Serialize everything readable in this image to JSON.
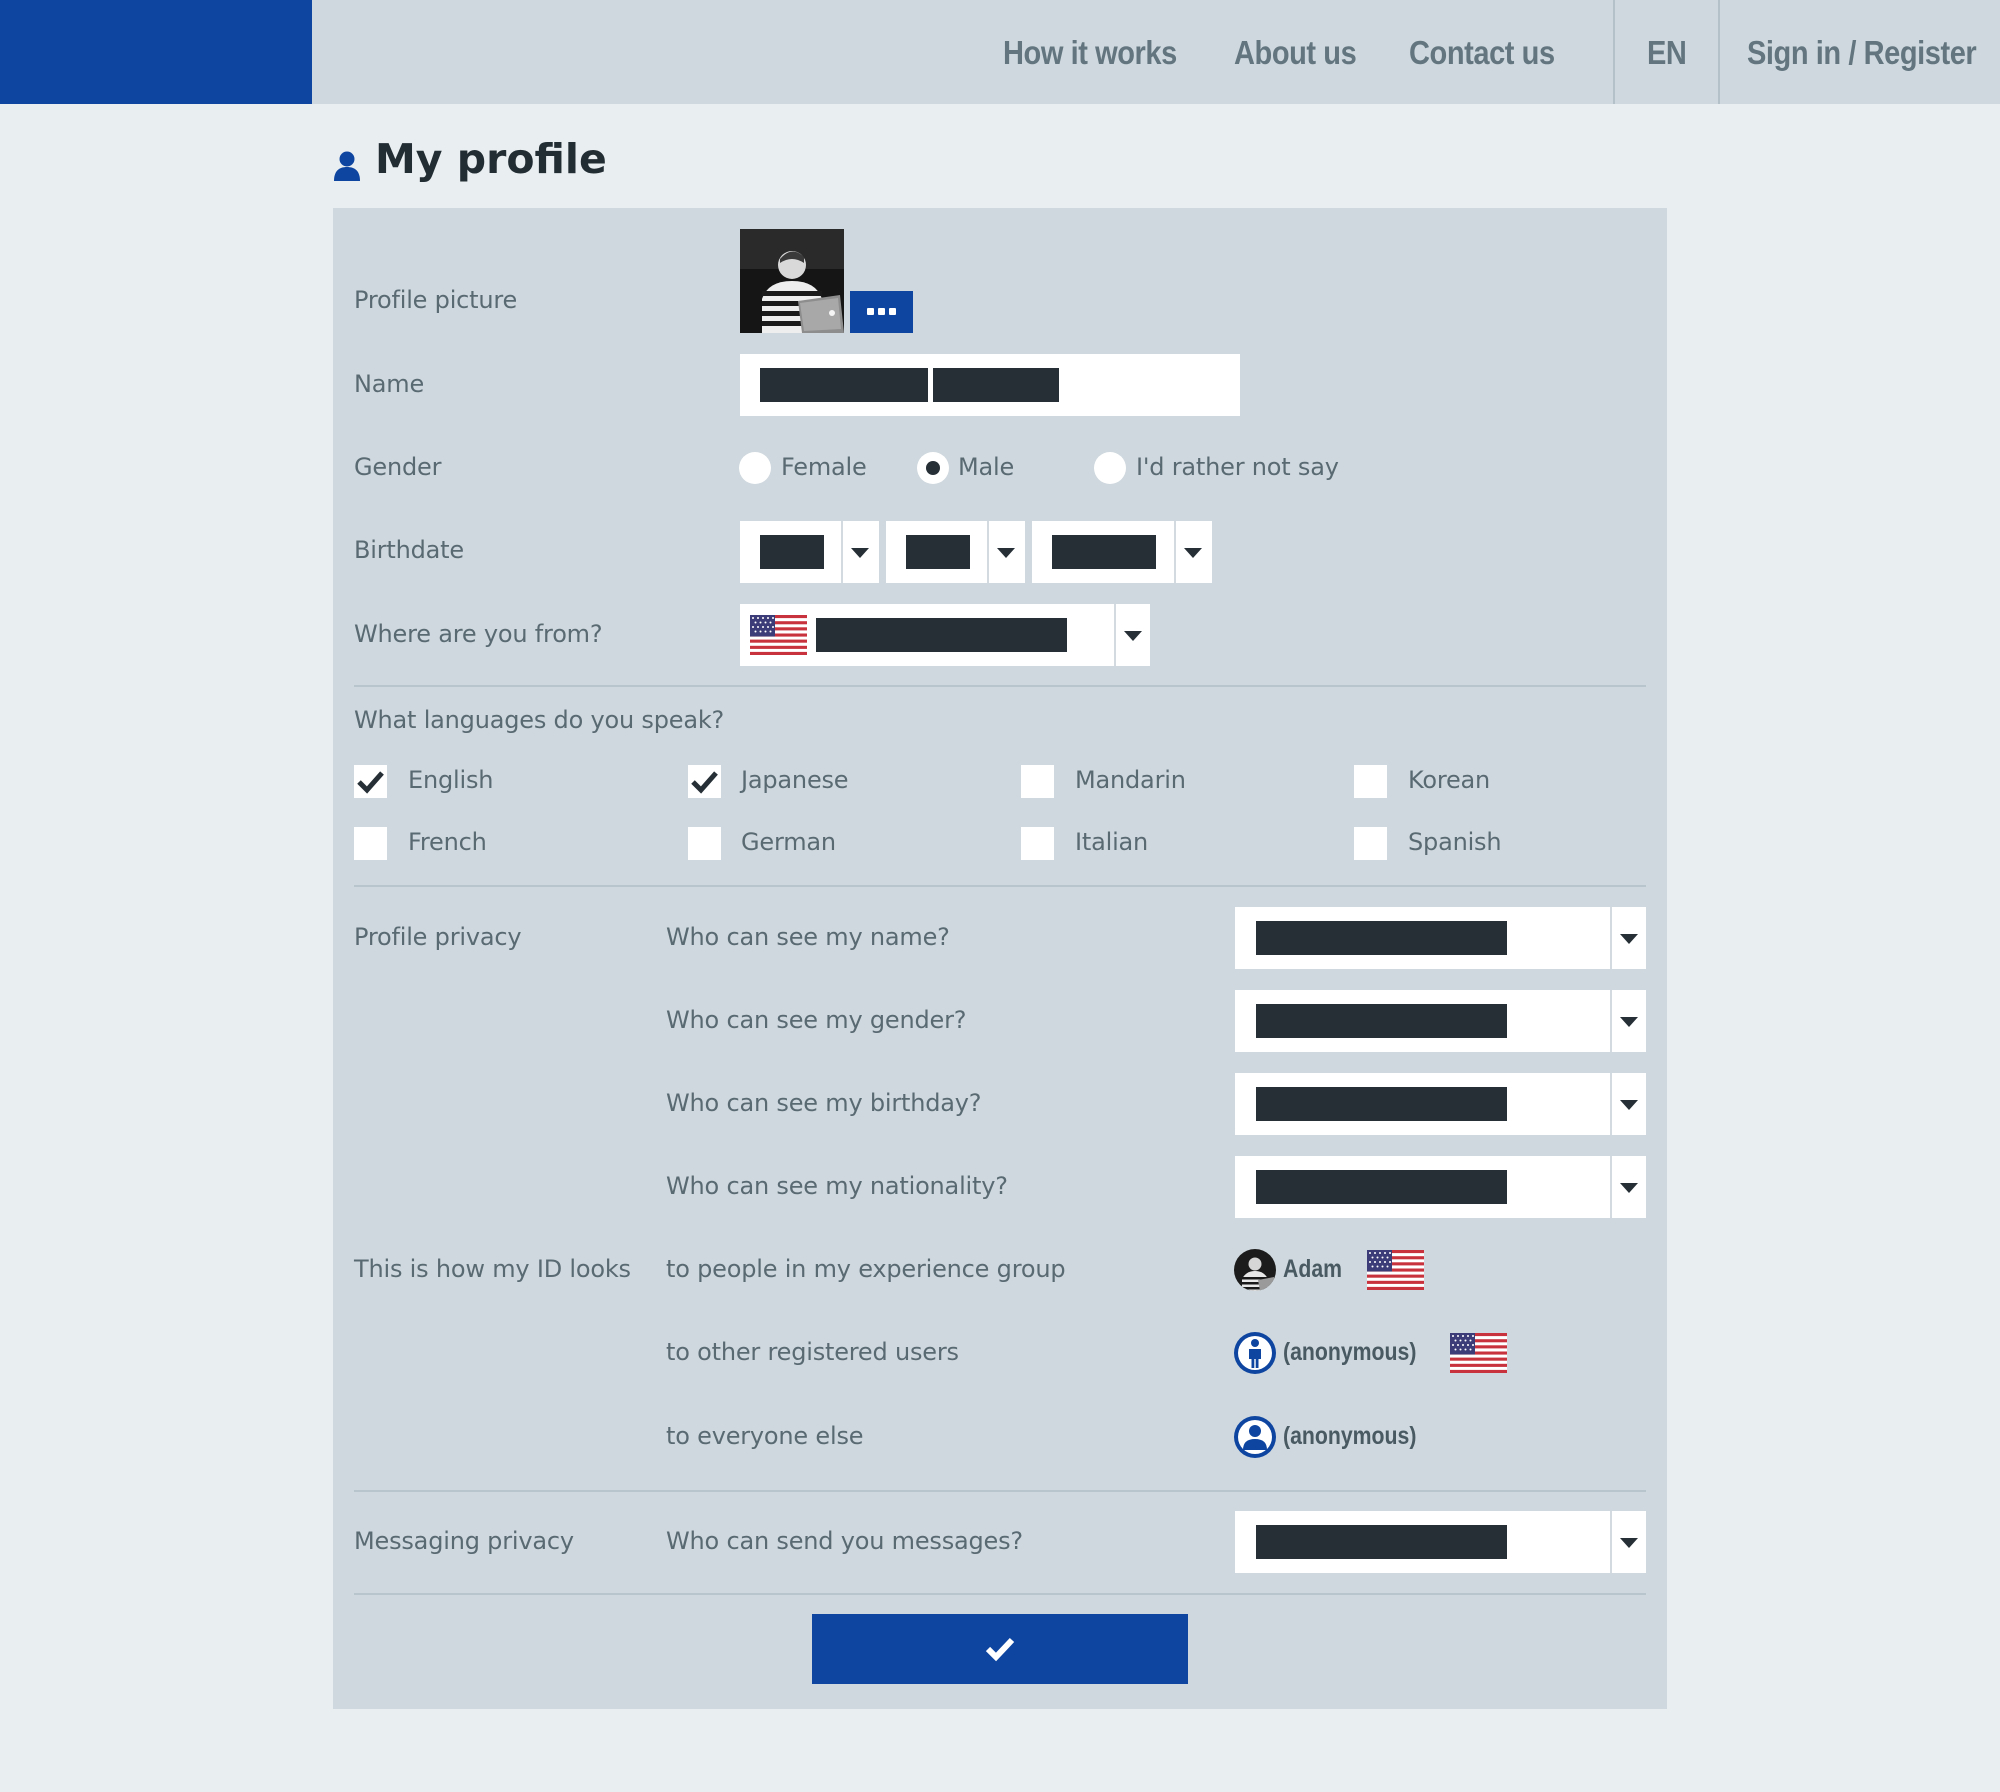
{
  "header": {
    "nav": {
      "how_it_works": "How it works",
      "about_us": "About us",
      "contact_us": "Contact us"
    },
    "language": "EN",
    "sign_in": "Sign in / Register",
    "brand_color": "#0e45a0"
  },
  "page": {
    "title": "My profile",
    "title_icon": "user-icon"
  },
  "form": {
    "profile_picture_label": "Profile picture",
    "picture_more_button": "more-dots-icon",
    "name_label": "Name",
    "gender_label": "Gender",
    "gender_options": {
      "female": "Female",
      "male": "Male",
      "not_say": "I'd rather not say"
    },
    "gender_selected": "Male",
    "birthdate_label": "Birthdate",
    "from_label": "Where are you from?",
    "from_flag": "us-flag-icon",
    "languages_label": "What languages do you speak?",
    "languages": [
      {
        "label": "English",
        "checked": true
      },
      {
        "label": "Japanese",
        "checked": true
      },
      {
        "label": "Mandarin",
        "checked": false
      },
      {
        "label": "Korean",
        "checked": false
      },
      {
        "label": "French",
        "checked": false
      },
      {
        "label": "German",
        "checked": false
      },
      {
        "label": "Italian",
        "checked": false
      },
      {
        "label": "Spanish",
        "checked": false
      }
    ],
    "privacy_label": "Profile privacy",
    "privacy_questions": {
      "name": "Who can see my name?",
      "gender": "Who can see my gender?",
      "birthday": "Who can see my birthday?",
      "nationality": "Who can see my nationality?"
    },
    "id_label": "This is how my ID looks",
    "id_rows": {
      "group": {
        "audience": "to people in my experience group",
        "display_name": "Adam"
      },
      "registered": {
        "audience": "to other registered users",
        "display_name": "(anonymous)"
      },
      "everyone": {
        "audience": "to everyone else",
        "display_name": "(anonymous)"
      }
    },
    "messaging_label": "Messaging privacy",
    "messaging_question": "Who can send you messages?",
    "submit_icon": "checkmark-icon"
  }
}
